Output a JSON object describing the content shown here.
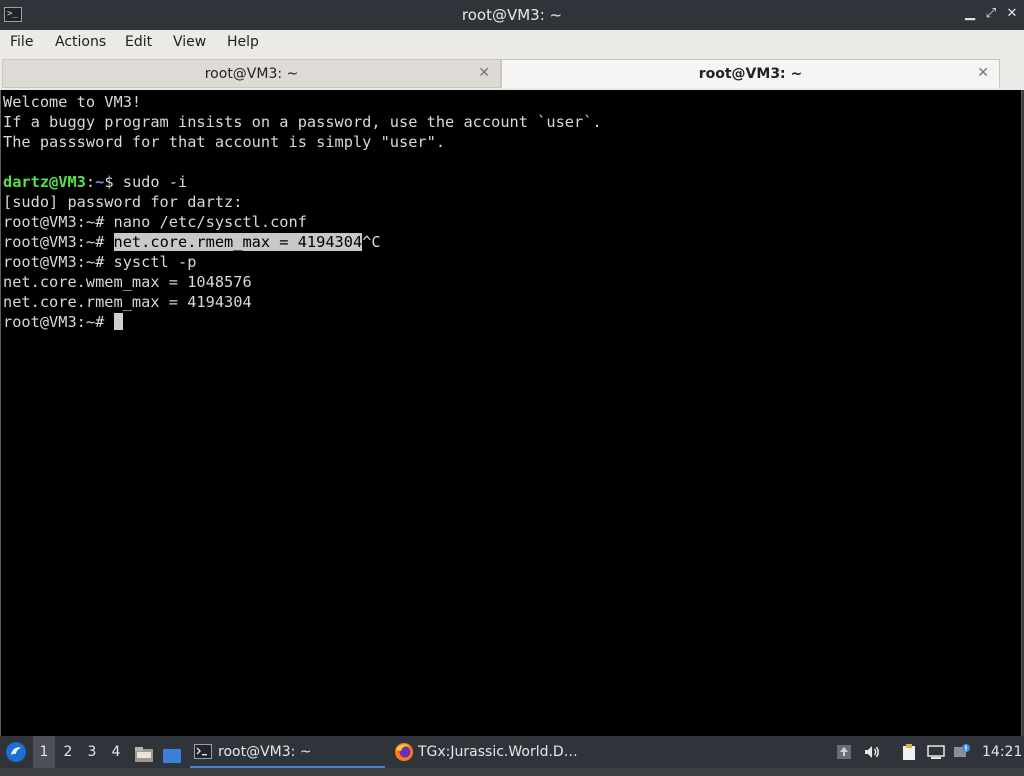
{
  "window": {
    "title": "root@VM3: ~",
    "app_icon_glyph": ">_",
    "controls": {
      "minimize": "▁",
      "maximize": "⤢",
      "close": "✕"
    }
  },
  "menu": [
    "File",
    "Actions",
    "Edit",
    "View",
    "Help"
  ],
  "tabs": [
    {
      "label": "root@VM3: ~",
      "active": false,
      "close": "✕"
    },
    {
      "label": "root@VM3: ~",
      "active": true,
      "close": "✕"
    }
  ],
  "terminal": {
    "lines": [
      [
        {
          "t": "Welcome to VM3!"
        }
      ],
      [
        {
          "t": "If a buggy program insists on a password, use the account `user`."
        }
      ],
      [
        {
          "t": "The passsword for that account is simply \"user\"."
        }
      ],
      [
        {
          "t": ""
        }
      ],
      [
        {
          "t": "dartz@VM3",
          "c": "u-green"
        },
        {
          "t": ":"
        },
        {
          "t": "~",
          "c": "u-blue"
        },
        {
          "t": "$ sudo -i"
        }
      ],
      [
        {
          "t": "[sudo] password for dartz:"
        }
      ],
      [
        {
          "t": "root@VM3:~# nano /etc/sysctl.conf"
        }
      ],
      [
        {
          "t": "root@VM3:~# "
        },
        {
          "t": "net.core.rmem_max = 4194304",
          "c": "sel"
        },
        {
          "t": "^C"
        }
      ],
      [
        {
          "t": "root@VM3:~# sysctl -p"
        }
      ],
      [
        {
          "t": "net.core.wmem_max = 1048576"
        }
      ],
      [
        {
          "t": "net.core.rmem_max = 4194304"
        }
      ],
      [
        {
          "t": "root@VM3:~# "
        },
        {
          "cursor": true
        }
      ]
    ]
  },
  "taskbar": {
    "workspaces": [
      "1",
      "2",
      "3",
      "4"
    ],
    "active_workspace": "1",
    "tasks": [
      {
        "label": "root@VM3: ~",
        "icon": "terminal-icon",
        "active": true
      },
      {
        "label": "TGx:Jurassic.World.D…",
        "icon": "firefox-icon",
        "active": false
      }
    ],
    "clock": "14:21"
  },
  "colors": {
    "user_green": "#56e04a",
    "path_blue": "#6d8bff",
    "selection": "#c8c8c8",
    "taskbar_accent": "#4c7fd1"
  }
}
